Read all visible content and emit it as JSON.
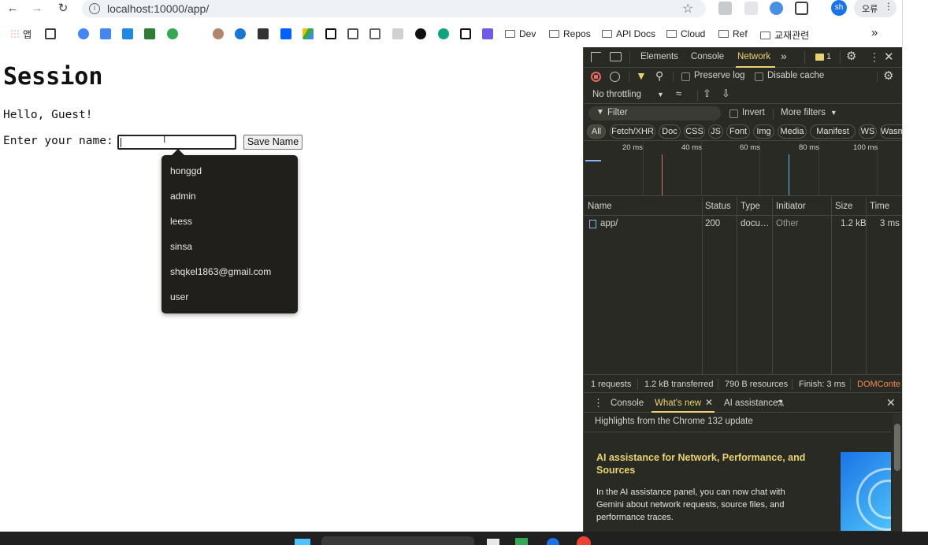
{
  "browser": {
    "url": "localhost:10000/app/",
    "profile_initials": "sh",
    "error_badge": "오류",
    "bookmarks": {
      "apps_label": "앱",
      "folders": [
        "Dev",
        "Repos",
        "API Docs",
        "Cloud",
        "Ref",
        "교재관련"
      ],
      "more": "»"
    }
  },
  "page": {
    "title": "Session",
    "greeting": "Hello, Guest!",
    "name_label": "Enter your name:",
    "name_value": "",
    "save_button": "Save Name",
    "autocomplete": [
      "honggd",
      "admin",
      "leess",
      "sinsa",
      "shqkel1863@gmail.com",
      "user"
    ]
  },
  "devtools": {
    "tabs": [
      "Elements",
      "Console",
      "Network"
    ],
    "active_tab": "Network",
    "issues_count": "1",
    "toolbar": {
      "preserve_log": "Preserve log",
      "disable_cache": "Disable cache",
      "throttling": "No throttling"
    },
    "filter": {
      "placeholder": "Filter",
      "invert": "Invert",
      "more_filters": "More filters"
    },
    "type_filters": [
      "All",
      "Fetch/XHR",
      "Doc",
      "CSS",
      "JS",
      "Font",
      "Img",
      "Media",
      "Manifest",
      "WS",
      "Wasm"
    ],
    "timeline_ticks": [
      "20 ms",
      "40 ms",
      "60 ms",
      "80 ms",
      "100 ms"
    ],
    "columns": [
      "Name",
      "Status",
      "Type",
      "Initiator",
      "Size",
      "Time"
    ],
    "rows": [
      {
        "name": "app/",
        "status": "200",
        "type": "docu…",
        "initiator": "Other",
        "size": "1.2 kB",
        "time": "3 ms"
      }
    ],
    "summary": {
      "requests": "1 requests",
      "transferred": "1.2 kB transferred",
      "resources": "790 B resources",
      "finish": "Finish: 3 ms",
      "domcontent": "DOMConte"
    },
    "drawer": {
      "tabs": [
        "Console",
        "What's new",
        "AI assistance"
      ],
      "active_tab": "What's new",
      "highlights": "Highlights from the Chrome 132 update",
      "article_title": "AI assistance for Network, Performance, and Sources",
      "article_body": "In the AI assistance panel, you can now chat with Gemini about network requests, source files, and performance traces."
    }
  },
  "colors": {
    "devtools_bg": "#292a24",
    "accent": "#e8d36e",
    "record": "#e46962",
    "link_blue": "#8ab4f8"
  }
}
